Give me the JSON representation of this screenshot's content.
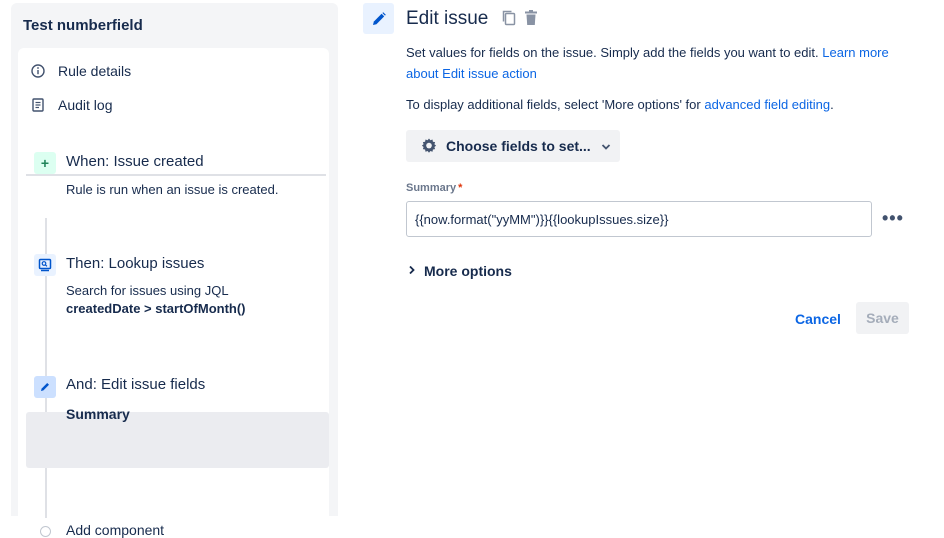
{
  "left": {
    "rule_title": "Test numberfield",
    "menu": [
      {
        "label": "Rule details",
        "icon": "info-icon"
      },
      {
        "label": "Audit log",
        "icon": "document-icon"
      }
    ],
    "components": [
      {
        "title": "When: Issue created",
        "desc": "Rule is run when an issue is created.",
        "icon": "plus-icon"
      },
      {
        "title": "Then: Lookup issues",
        "desc": "Search for issues using JQL",
        "desc_bold": "createdDate > startOfMonth()",
        "icon": "lookup-icon"
      },
      {
        "title": "And: Edit issue fields",
        "desc_bold": "Summary",
        "icon": "pencil-icon"
      }
    ],
    "add_component": "Add component"
  },
  "right": {
    "title": "Edit issue",
    "desc_line1": "Set values for fields on the issue. Simply add the fields you want to edit.",
    "learn_link": "Learn more about Edit issue action",
    "desc_line2": "To display additional fields, select 'More options' for",
    "advanced_link": "advanced field editing",
    "period": ".",
    "choose_fields_label": "Choose fields to set...",
    "field_label": "Summary",
    "required_marker": "*",
    "field_value": "{{now.format(\"yyMM\")}}{{lookupIssues.size}}",
    "more_options": "More options",
    "cancel_label": "Cancel",
    "save_label": "Save"
  },
  "colors": {
    "accent": "#0c66e4",
    "trigger_green": "#1f845a",
    "action_blue": "#0055cc"
  }
}
